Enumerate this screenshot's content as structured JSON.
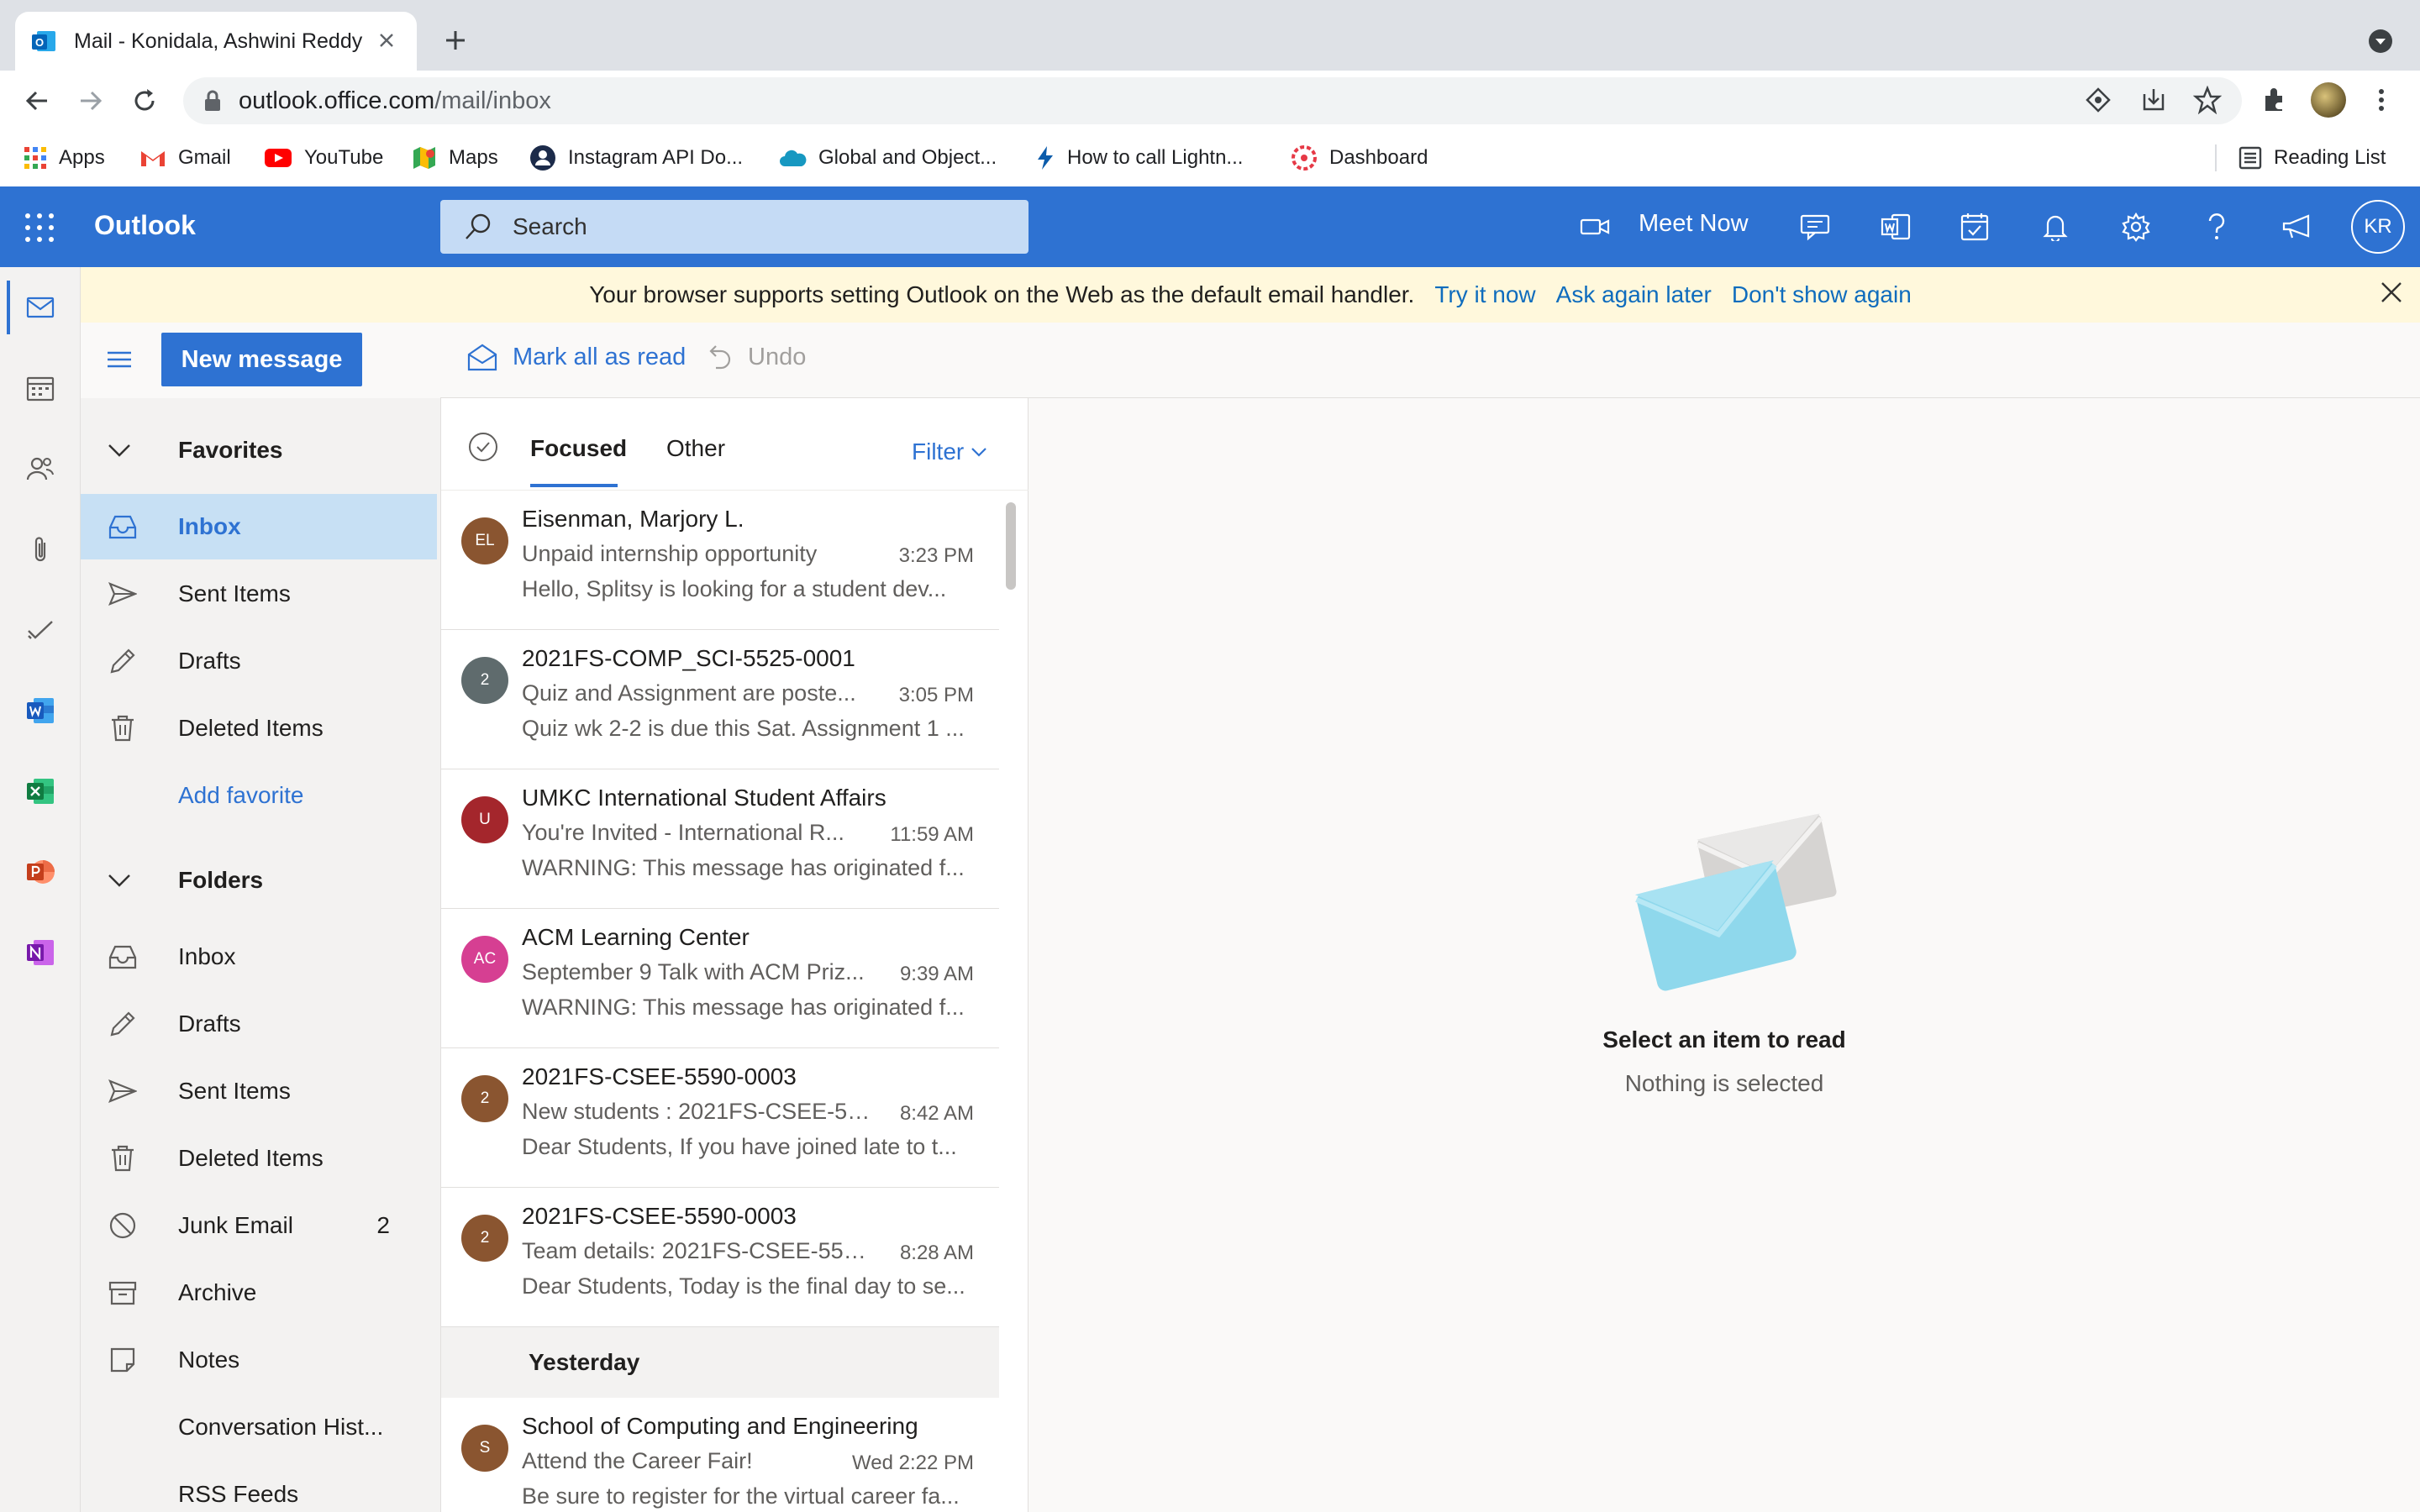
{
  "browser": {
    "tab_title": "Mail - Konidala, Ashwini Reddy",
    "new_tab": "+",
    "url_host": "outlook.office.com",
    "url_path": "/mail/inbox",
    "bookmarks": [
      {
        "label": "Apps",
        "icon": "apps-grid-icon"
      },
      {
        "label": "Gmail",
        "icon": "gmail-icon"
      },
      {
        "label": "YouTube",
        "icon": "youtube-icon"
      },
      {
        "label": "Maps",
        "icon": "maps-icon"
      },
      {
        "label": "Instagram API Do...",
        "icon": "instagram-icon"
      },
      {
        "label": "Global and Object...",
        "icon": "cloud-icon"
      },
      {
        "label": "How to call Lightn...",
        "icon": "lightning-icon"
      },
      {
        "label": "Dashboard",
        "icon": "dashboard-icon"
      }
    ],
    "reading_list": "Reading List"
  },
  "header": {
    "app_name": "Outlook",
    "search_placeholder": "Search",
    "meet_now": "Meet Now",
    "avatar_initials": "KR"
  },
  "banner": {
    "message": "Your browser supports setting Outlook on the Web as the default email handler.",
    "try_it": "Try it now",
    "ask_later": "Ask again later",
    "dont_show": "Don't show again"
  },
  "commands": {
    "new_message": "New message",
    "mark_all_read": "Mark all as read",
    "undo": "Undo"
  },
  "folders": {
    "favorites_heading": "Favorites",
    "favorites": [
      {
        "label": "Inbox"
      },
      {
        "label": "Sent Items"
      },
      {
        "label": "Drafts"
      },
      {
        "label": "Deleted Items"
      }
    ],
    "add_favorite": "Add favorite",
    "folders_heading": "Folders",
    "items": [
      {
        "label": "Inbox",
        "count": ""
      },
      {
        "label": "Drafts",
        "count": ""
      },
      {
        "label": "Sent Items",
        "count": ""
      },
      {
        "label": "Deleted Items",
        "count": ""
      },
      {
        "label": "Junk Email",
        "count": "2"
      },
      {
        "label": "Archive",
        "count": ""
      },
      {
        "label": "Notes",
        "count": ""
      },
      {
        "label": "Conversation Hist...",
        "count": ""
      },
      {
        "label": "RSS Feeds",
        "count": ""
      }
    ]
  },
  "list": {
    "tab_focused": "Focused",
    "tab_other": "Other",
    "filter": "Filter",
    "messages": [
      {
        "initials": "EL",
        "color": "#8a5530",
        "sender": "Eisenman, Marjory L.",
        "subject": "Unpaid internship opportunity",
        "time": "3:23 PM",
        "preview": "Hello, Splitsy is looking for a student dev..."
      },
      {
        "initials": "2",
        "color": "#5f6b6d",
        "sender": "2021FS-COMP_SCI-5525-0001",
        "subject": "Quiz and Assignment are poste...",
        "time": "3:05 PM",
        "preview": "Quiz wk 2-2 is due this Sat. Assignment 1 ..."
      },
      {
        "initials": "U",
        "color": "#a4262c",
        "sender": "UMKC International Student Affairs",
        "subject": "You're Invited - International R...",
        "time": "11:59 AM",
        "preview": "WARNING: This message has originated f..."
      },
      {
        "initials": "AC",
        "color": "#d63f92",
        "sender": "ACM Learning Center",
        "subject": "September 9 Talk with ACM Priz...",
        "time": "9:39 AM",
        "preview": "WARNING: This message has originated f..."
      },
      {
        "initials": "2",
        "color": "#8a5530",
        "sender": "2021FS-CSEE-5590-0003",
        "subject": "New students : 2021FS-CSEE-55...",
        "time": "8:42 AM",
        "preview": "Dear Students, If you have joined late to t..."
      },
      {
        "initials": "2",
        "color": "#8a5530",
        "sender": "2021FS-CSEE-5590-0003",
        "subject": "Team details: 2021FS-CSEE-559...",
        "time": "8:28 AM",
        "preview": "Dear Students, Today is the final day to se..."
      }
    ],
    "group_yesterday": "Yesterday",
    "yesterday_messages": [
      {
        "initials": "S",
        "color": "#8a5530",
        "sender": "School of Computing and Engineering",
        "subject": "Attend the Career Fair!",
        "time": "Wed 2:22 PM",
        "preview": "Be sure to register for the virtual career fa..."
      }
    ]
  },
  "reading": {
    "title": "Select an item to read",
    "subtitle": "Nothing is selected"
  }
}
